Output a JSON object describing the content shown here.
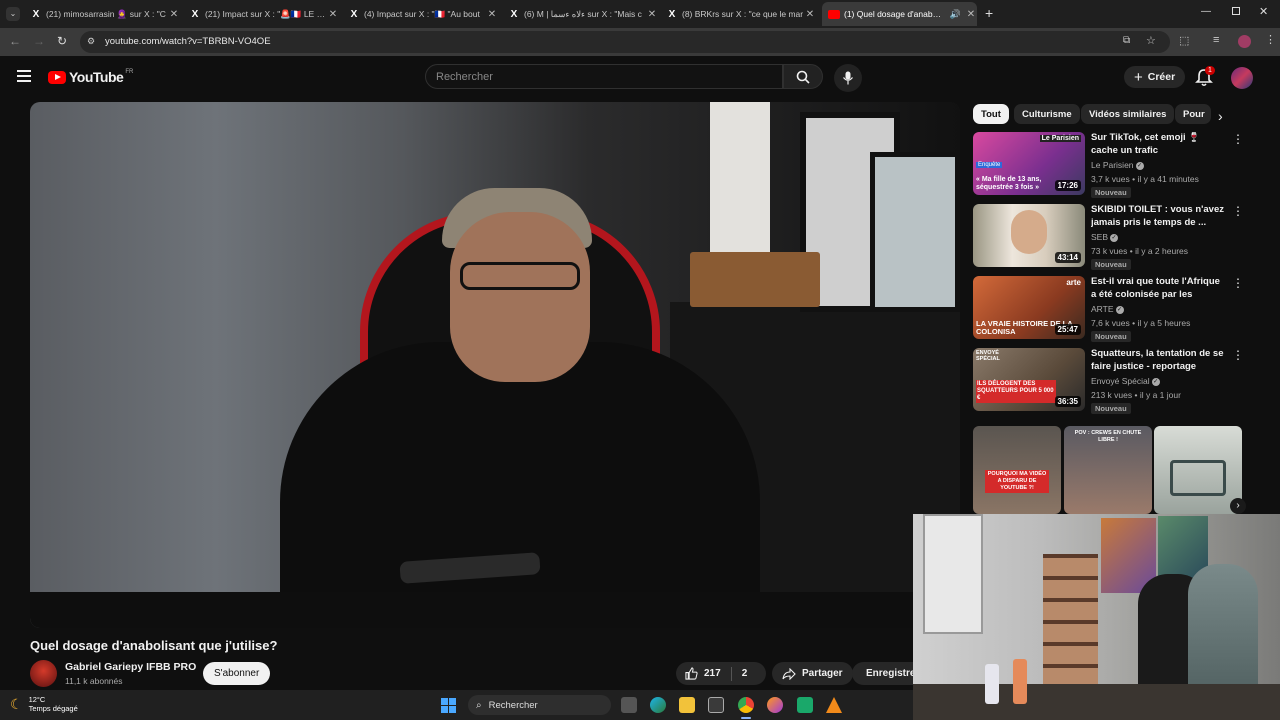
{
  "browser": {
    "tabs": [
      {
        "title": "(21) mimosarrasin 🧕 sur X : \"C",
        "icon": "x-logo-icon",
        "active": false
      },
      {
        "title": "(21) Impact sur X : \"🚨🇫🇷 LE RA",
        "icon": "x-logo-icon",
        "active": false
      },
      {
        "title": "(4) Impact sur X : \"🇫🇷 \"Au bout",
        "icon": "x-logo-icon",
        "active": false
      },
      {
        "title": "(6) M | ءلاه ءسما sur X : \"Mais c",
        "icon": "x-logo-icon",
        "active": false
      },
      {
        "title": "(8) BRKrs sur X : \"ce que le mar",
        "icon": "x-logo-icon",
        "active": false
      },
      {
        "title": "(1) Quel dosage d'anabolisan",
        "icon": "youtube-favicon-icon",
        "active": true
      }
    ],
    "new_tab_label": "+",
    "url": "youtube.com/watch?v=TBRBN-VO4OE"
  },
  "youtube": {
    "logo_text": "YouTube",
    "country_code": "FR",
    "search_placeholder": "Rechercher",
    "create_label": "Créer",
    "notification_count": "1",
    "chips": [
      "Tout",
      "Culturisme",
      "Vidéos similaires",
      "Pour"
    ],
    "video": {
      "title": "Quel dosage d'anabolisant que j'utilise?",
      "channel": "Gabriel Gariepy IFBB PRO",
      "subscribers": "11,1 k abonnés",
      "subscribe_label": "S'abonner",
      "likes": "217",
      "comments_count": "2",
      "share_label": "Partager",
      "save_label": "Enregistrer"
    },
    "recommendations": [
      {
        "title": "Sur TikTok, cet emoji 🍷 cache un trafic d'adolescentes",
        "channel": "Le Parisien",
        "views": "3,7 k vues",
        "age": "il y a 41 minutes",
        "badge": "Nouveau",
        "duration": "17:26",
        "thumb_caption": "« Ma fille de 13 ans, séquestrée 3 fois »",
        "thumb_logo": "Le Parisien",
        "thumb_tag": "Enquête",
        "thumb_color": "#b04aa8"
      },
      {
        "title": "SKIBIDI TOILET : vous n'avez jamais pris le temps de ...",
        "channel": "SEB",
        "views": "73 k vues",
        "age": "il y a 2 heures",
        "badge": "Nouveau",
        "duration": "43:14",
        "thumb_caption": "",
        "thumb_color": "#8a7a62"
      },
      {
        "title": "Est-il vrai que toute l'Afrique a été colonisée par les Européen...",
        "channel": "ARTE",
        "views": "7,6 k vues",
        "age": "il y a 5 heures",
        "badge": "Nouveau",
        "duration": "25:47",
        "thumb_caption": "LA VRAIE HISTOIRE DE LA COLONISA",
        "thumb_logo": "arte",
        "thumb_color": "#c0552e"
      },
      {
        "title": "Squatteurs, la tentation de se faire justice - reportage intégral",
        "channel": "Envoyé Spécial",
        "views": "213 k vues",
        "age": "il y a 1 jour",
        "badge": "Nouveau",
        "duration": "36:35",
        "thumb_caption": "ILS DÉLOGENT DES SQUATTEURS POUR 5 000 €",
        "thumb_logo": "ENVOYÉ SPÉCIAL",
        "thumb_color": "#6b5a48"
      }
    ],
    "shorts": [
      {
        "caption": "POURQUOI MA VIDÉO A DISPARU DE YOUTUBE ?!",
        "color": "#6a6058"
      },
      {
        "caption": "POV : CREWS EN CHUTE LIBRE !",
        "color": "#7a6a5a"
      },
      {
        "caption": "",
        "color": "#c8ccc6"
      }
    ]
  },
  "taskbar": {
    "temperature": "12°C",
    "weather": "Temps dégagé",
    "search_label": "Rechercher",
    "apps": [
      "task-view-icon",
      "edge-icon",
      "file-explorer-icon",
      "store-icon",
      "chrome-icon",
      "firefox-icon",
      "app-icon",
      "vlc-icon"
    ]
  }
}
